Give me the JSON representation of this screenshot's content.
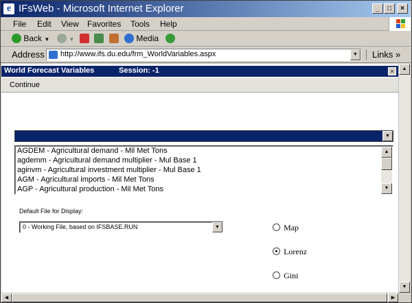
{
  "window": {
    "title": "IFsWeb - Microsoft Internet Explorer",
    "icon": "ie-icon",
    "buttons": {
      "minimize": "_",
      "maximize": "□",
      "close": "×"
    }
  },
  "menu": [
    {
      "label": "File"
    },
    {
      "label": "Edit"
    },
    {
      "label": "View"
    },
    {
      "label": "Favorites"
    },
    {
      "label": "Tools"
    },
    {
      "label": "Help"
    }
  ],
  "toolbar": {
    "back_label": "Back",
    "media_label": "Media"
  },
  "address": {
    "label": "Address",
    "url": "http://www.ifs.du.edu/frm_WorldVariables.aspx",
    "links_label": "Links",
    "links_chevron": "»"
  },
  "app": {
    "title": "World Forecast Variables",
    "session": "Session: -1",
    "close": "×",
    "continue_label": "Continue"
  },
  "variable_select": {
    "value": ""
  },
  "variable_list": [
    "AGDEM - Agricultural demand - Mil Met Tons",
    "agdemm - Agricultural demand multiplier - Mul Base 1",
    "aginvm - Agricultural investment multiplier - Mul Base 1",
    "AGM - Agricultural imports - Mil Met Tons",
    "AGP - Agricultural production - Mil Met Tons"
  ],
  "default_file": {
    "label": "Default File for Display:",
    "value": "0 - Working File, based on IFSBASE.RUN"
  },
  "display_options": [
    {
      "label": "Map",
      "checked": false
    },
    {
      "label": "Lorenz",
      "checked": true
    },
    {
      "label": "Gini",
      "checked": false
    }
  ],
  "colors": {
    "titlebar_start": "#0a246a",
    "titlebar_end": "#a6caf0",
    "app_header": "#0a246a",
    "chrome": "#d4d0c8"
  }
}
